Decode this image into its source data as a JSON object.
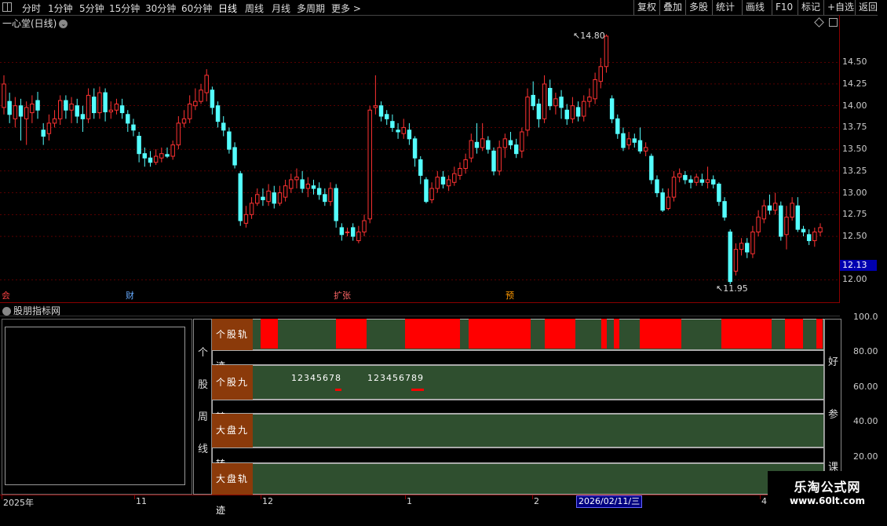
{
  "toolbar": {
    "periods": [
      "分时",
      "1分钟",
      "5分钟",
      "15分钟",
      "30分钟",
      "60分钟",
      "日线",
      "周线",
      "月线",
      "多周期",
      "更多 >"
    ],
    "active_period": "日线",
    "right_buttons": [
      "复权",
      "叠加",
      "多股",
      "统计",
      "画线",
      "F10",
      "标记",
      "+自选",
      "返回"
    ]
  },
  "chart": {
    "title": "一心堂(日线)",
    "price_labels": [
      "14.50",
      "14.25",
      "14.00",
      "13.75",
      "13.50",
      "13.25",
      "13.00",
      "12.75",
      "12.50",
      "12.00"
    ],
    "current_price": "12.13",
    "high_annotation": "14.80",
    "low_annotation": "11.95",
    "events": [
      {
        "label": "会",
        "color": "#ff4444"
      },
      {
        "label": "财",
        "color": "#66aaff"
      },
      {
        "label": "扩张",
        "color": "#ff6666"
      },
      {
        "label": "预",
        "color": "#ff9900"
      }
    ],
    "up_color": "#ff3232",
    "down_color": "#54ffff"
  },
  "chart_data": {
    "type": "candlestick",
    "ylim": [
      11.95,
      14.8
    ],
    "candles": [
      [
        13.98,
        14.25,
        14.35,
        13.9
      ],
      [
        14.05,
        13.9,
        14.15,
        13.8
      ],
      [
        13.85,
        14.0,
        14.1,
        13.75
      ],
      [
        14.0,
        13.88,
        14.08,
        13.6
      ],
      [
        13.85,
        13.98,
        14.05,
        13.55
      ],
      [
        13.92,
        14.02,
        14.12,
        13.8
      ],
      [
        14.06,
        13.95,
        14.16,
        13.85
      ],
      [
        13.72,
        13.65,
        13.8,
        13.55
      ],
      [
        13.68,
        13.8,
        13.9,
        13.6
      ],
      [
        13.8,
        13.85,
        13.95,
        13.75
      ],
      [
        13.85,
        14.06,
        14.12,
        13.78
      ],
      [
        14.06,
        13.95,
        14.12,
        13.85
      ],
      [
        13.95,
        14.02,
        14.1,
        13.8
      ],
      [
        14.0,
        13.88,
        14.08,
        13.8
      ],
      [
        13.9,
        13.85,
        14.0,
        13.7
      ],
      [
        13.85,
        14.12,
        14.2,
        13.8
      ],
      [
        14.1,
        13.92,
        14.2,
        13.85
      ],
      [
        13.92,
        14.15,
        14.22,
        13.85
      ],
      [
        14.15,
        13.93,
        14.2,
        13.82
      ],
      [
        13.93,
        13.95,
        14.05,
        13.85
      ],
      [
        13.95,
        14.02,
        14.08,
        13.9
      ],
      [
        14.0,
        13.92,
        14.08,
        13.85
      ],
      [
        13.9,
        13.8,
        13.95,
        13.7
      ],
      [
        13.78,
        13.72,
        13.85,
        13.65
      ],
      [
        13.65,
        13.45,
        13.7,
        13.35
      ],
      [
        13.45,
        13.4,
        13.52,
        13.3
      ],
      [
        13.4,
        13.35,
        13.48,
        13.3
      ],
      [
        13.35,
        13.42,
        13.5,
        13.32
      ],
      [
        13.4,
        13.45,
        13.52,
        13.35
      ],
      [
        13.44,
        13.42,
        13.52,
        13.4
      ],
      [
        13.42,
        13.55,
        13.6,
        13.38
      ],
      [
        13.55,
        13.8,
        13.88,
        13.5
      ],
      [
        13.8,
        13.85,
        13.95,
        13.75
      ],
      [
        13.85,
        14.02,
        14.12,
        13.8
      ],
      [
        14.0,
        14.05,
        14.2,
        13.95
      ],
      [
        14.05,
        14.18,
        14.25,
        14.02
      ],
      [
        14.15,
        14.35,
        14.42,
        14.05
      ],
      [
        14.18,
        13.98,
        14.22,
        13.9
      ],
      [
        14.0,
        13.82,
        14.05,
        13.75
      ],
      [
        13.8,
        13.72,
        13.88,
        13.65
      ],
      [
        13.7,
        13.5,
        13.75,
        13.45
      ],
      [
        13.52,
        13.32,
        13.58,
        13.28
      ],
      [
        13.22,
        12.68,
        13.25,
        12.62
      ],
      [
        12.65,
        12.75,
        12.85,
        12.6
      ],
      [
        12.75,
        12.88,
        12.95,
        12.7
      ],
      [
        12.88,
        12.98,
        13.05,
        12.85
      ],
      [
        12.95,
        12.92,
        13.05,
        12.85
      ],
      [
        12.9,
        13.02,
        13.1,
        12.85
      ],
      [
        13.0,
        12.88,
        13.08,
        12.82
      ],
      [
        12.88,
        13.0,
        13.08,
        12.85
      ],
      [
        12.95,
        13.08,
        13.15,
        12.9
      ],
      [
        13.05,
        13.15,
        13.22,
        13.0
      ],
      [
        13.15,
        13.18,
        13.28,
        13.05
      ],
      [
        13.15,
        13.05,
        13.25,
        13.0
      ],
      [
        13.05,
        13.1,
        13.18,
        12.95
      ],
      [
        13.08,
        13.05,
        13.15,
        12.98
      ],
      [
        13.05,
        12.98,
        13.12,
        12.92
      ],
      [
        12.98,
        12.9,
        13.05,
        12.85
      ],
      [
        12.9,
        13.05,
        13.12,
        12.85
      ],
      [
        13.05,
        12.68,
        13.1,
        12.6
      ],
      [
        12.6,
        12.52,
        12.65,
        12.45
      ],
      [
        12.55,
        12.55,
        12.6,
        12.5
      ],
      [
        12.6,
        12.5,
        12.65,
        12.45
      ],
      [
        12.45,
        12.55,
        12.62,
        12.42
      ],
      [
        12.55,
        12.68,
        12.75,
        12.5
      ],
      [
        12.7,
        13.95,
        14.0,
        12.65
      ],
      [
        13.98,
        14.0,
        14.35,
        13.9
      ],
      [
        14.0,
        13.88,
        14.05,
        13.82
      ],
      [
        13.9,
        13.85,
        13.95,
        13.78
      ],
      [
        13.82,
        13.75,
        13.9,
        13.7
      ],
      [
        13.72,
        13.7,
        13.8,
        13.62
      ],
      [
        13.68,
        13.75,
        13.85,
        13.62
      ],
      [
        13.72,
        13.62,
        13.8,
        13.55
      ],
      [
        13.62,
        13.4,
        13.65,
        13.3
      ],
      [
        13.38,
        13.2,
        13.42,
        13.1
      ],
      [
        13.15,
        12.9,
        13.18,
        12.88
      ],
      [
        12.92,
        13.05,
        13.12,
        12.88
      ],
      [
        13.05,
        13.18,
        13.25,
        13.0
      ],
      [
        13.18,
        13.1,
        13.25,
        13.05
      ],
      [
        13.08,
        13.15,
        13.2,
        13.02
      ],
      [
        13.12,
        13.22,
        13.3,
        13.08
      ],
      [
        13.2,
        13.28,
        13.35,
        13.15
      ],
      [
        13.28,
        13.38,
        13.45,
        13.22
      ],
      [
        13.4,
        13.6,
        13.68,
        13.35
      ],
      [
        13.58,
        13.52,
        13.8,
        13.45
      ],
      [
        13.52,
        13.62,
        13.8,
        13.48
      ],
      [
        13.6,
        13.5,
        13.65,
        13.45
      ],
      [
        13.48,
        13.25,
        13.52,
        13.2
      ],
      [
        13.25,
        13.52,
        13.6,
        13.2
      ],
      [
        13.52,
        13.62,
        13.68,
        13.4
      ],
      [
        13.6,
        13.55,
        13.7,
        13.5
      ],
      [
        13.55,
        13.45,
        13.62,
        13.4
      ],
      [
        13.48,
        13.7,
        13.75,
        13.4
      ],
      [
        13.72,
        14.1,
        14.2,
        13.65
      ],
      [
        14.12,
        14.0,
        14.28,
        13.95
      ],
      [
        14.02,
        13.85,
        14.08,
        13.75
      ],
      [
        13.85,
        14.25,
        14.35,
        13.8
      ],
      [
        14.2,
        14.0,
        14.3,
        13.95
      ],
      [
        14.0,
        14.08,
        14.15,
        13.9
      ],
      [
        14.1,
        13.98,
        14.18,
        13.85
      ],
      [
        13.95,
        13.85,
        14.02,
        13.78
      ],
      [
        13.85,
        14.0,
        14.1,
        13.8
      ],
      [
        13.98,
        13.88,
        14.05,
        13.82
      ],
      [
        13.88,
        14.05,
        14.12,
        13.82
      ],
      [
        14.05,
        14.1,
        14.2,
        13.98
      ],
      [
        14.08,
        14.3,
        14.38,
        14.02
      ],
      [
        14.28,
        14.45,
        14.55,
        14.2
      ],
      [
        14.45,
        14.8,
        14.82,
        14.38
      ],
      [
        14.08,
        13.85,
        14.12,
        13.8
      ],
      [
        13.85,
        13.68,
        13.9,
        13.62
      ],
      [
        13.68,
        13.52,
        13.75,
        13.48
      ],
      [
        13.55,
        13.62,
        13.7,
        13.5
      ],
      [
        13.62,
        13.58,
        13.68,
        13.52
      ],
      [
        13.6,
        13.48,
        13.75,
        13.45
      ],
      [
        13.48,
        13.52,
        13.58,
        13.42
      ],
      [
        13.42,
        13.15,
        13.45,
        13.1
      ],
      [
        13.15,
        13.0,
        13.2,
        12.95
      ],
      [
        13.0,
        12.8,
        13.05,
        12.78
      ],
      [
        12.82,
        12.95,
        13.05,
        12.8
      ],
      [
        12.95,
        13.18,
        13.25,
        12.9
      ],
      [
        13.18,
        13.22,
        13.28,
        13.12
      ],
      [
        13.2,
        13.15,
        13.25,
        13.1
      ],
      [
        13.15,
        13.12,
        13.2,
        13.05
      ],
      [
        13.12,
        13.18,
        13.22,
        13.08
      ],
      [
        13.15,
        13.12,
        13.22,
        13.08
      ],
      [
        13.12,
        13.15,
        13.3,
        13.05
      ],
      [
        13.15,
        13.1,
        13.2,
        13.05
      ],
      [
        13.1,
        12.9,
        13.12,
        12.85
      ],
      [
        12.9,
        12.72,
        12.95,
        12.68
      ],
      [
        12.55,
        11.98,
        12.58,
        11.95
      ],
      [
        12.1,
        12.35,
        12.42,
        12.05
      ],
      [
        12.35,
        12.42,
        12.48,
        12.28
      ],
      [
        12.42,
        12.32,
        12.48,
        12.25
      ],
      [
        12.3,
        12.55,
        12.62,
        12.25
      ],
      [
        12.55,
        12.72,
        12.8,
        12.5
      ],
      [
        12.7,
        12.85,
        12.92,
        12.65
      ],
      [
        12.85,
        12.8,
        12.98,
        12.75
      ],
      [
        12.8,
        12.88,
        13.0,
        12.75
      ],
      [
        12.85,
        12.5,
        12.9,
        12.45
      ],
      [
        12.52,
        12.72,
        12.85,
        12.35
      ],
      [
        12.72,
        12.88,
        12.95,
        12.68
      ],
      [
        12.85,
        12.58,
        12.95,
        12.55
      ],
      [
        12.58,
        12.55,
        12.62,
        12.5
      ],
      [
        12.52,
        12.45,
        12.58,
        12.4
      ],
      [
        12.45,
        12.55,
        12.6,
        12.38
      ],
      [
        12.55,
        12.6,
        12.65,
        12.5
      ]
    ]
  },
  "indicator": {
    "title": "股朋指标网",
    "side_chars": [
      "个",
      "股",
      "周",
      "线"
    ],
    "right_chars": [
      "好",
      "参",
      "课"
    ],
    "bands": [
      {
        "label": "个股轨迹"
      },
      {
        "label": "个股九转"
      },
      {
        "label": "大盘九转"
      },
      {
        "label": "大盘轨迹"
      }
    ],
    "nine_turn_a": "12345678",
    "nine_turn_b": "123456789",
    "scale": [
      "100.0",
      "80.00",
      "60.00",
      "40.00",
      "20.00"
    ]
  },
  "bottom_axis": {
    "labels": [
      "2025年",
      "11",
      "12",
      "1",
      "2",
      "4"
    ],
    "selected_date": "2026/02/11/三"
  },
  "watermark": {
    "line1": "乐淘公式网",
    "line2": "www.60lt.com"
  }
}
